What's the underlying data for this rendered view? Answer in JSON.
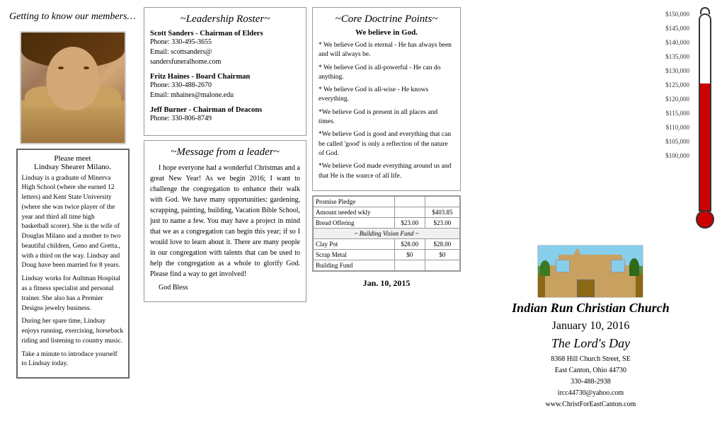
{
  "member": {
    "header": "Getting to know our members…",
    "please_meet": "Please meet",
    "name": "Lindsay Shearer Milano.",
    "bio_1": "Lindsay is a graduate of Minerva High School (where she earned 12 letters) and Kent State University (where she was twice player of the year and third all time high basketball scorer). She is the wife of Douglas Milano and a mother to two beautiful children, Geno and Gretta., with a third on the way. Lindsay and Doug have been married for 8 years.",
    "bio_2": "Lindsay works for Aultman Hospital as a fitness specialist and personal trainer. She also has a Premier Designs jewelry business.",
    "bio_3": "During her spare time, Lindsay enjoys running, exercising, horseback riding and listening to country music.",
    "bio_4": "Take a minute to introduce yourself to Lindsay today."
  },
  "leadership": {
    "title": "~Leadership Roster~",
    "leaders": [
      {
        "name": "Scott Sanders - Chairman of Elders",
        "phone": "Phone: 330-495-3655",
        "email": "Email: scottsanders@",
        "email2": "sandersfuneralhome.com"
      },
      {
        "name": "Fritz Haines - Board Chairman",
        "phone": "Phone: 330-488-2670",
        "email": "Email: mhaines@malone.edu"
      },
      {
        "name": "Jeff Burner - Chairman of Deacons",
        "phone": "Phone: 330-806-8749"
      }
    ]
  },
  "message": {
    "title": "~Message from a leader~",
    "text": "I hope everyone had a wonderful Christmas and a great New Year! As we begin 2016; I want to challenge the congregation to enhance their walk with God. We have many opportunities: gardening, scrapping, painting, building, Vacation Bible School, just to name a few. You may have a project in mind that we as a congregation can begin this year; if so I would love to learn about it. There are many people in our congregation with talents that can be used to help the congregation as a whole to glorify God. Please find a way to get involved!",
    "closing": "God Bless"
  },
  "doctrine": {
    "title": "~Core Doctrine Points~",
    "subtitle": "We believe in God.",
    "points": [
      "* We believe God is eternal - He has always been and will always be.",
      "* We believe God is all-powerful - He can do anything.",
      "* We believe God is all-wise - He knows everything.",
      "*We believe God is present in all places and times.",
      "*We believe God is good and everything that can be called 'good' is only a reflection of the nature of God.",
      "*We believe God made everything around us and that He is the source of all life."
    ]
  },
  "finance_table": {
    "rows": [
      {
        "label": "Promise Pledge",
        "col1": "",
        "col2": ""
      },
      {
        "label": "Amount needed wkly",
        "col1": "",
        "col2": "$403.85"
      },
      {
        "label": "Bread Offering",
        "col1": "$23.00",
        "col2": "$23.00"
      },
      {
        "label": "fund_header",
        "col1": "~ Building Vision Fund ~",
        "col2": ""
      },
      {
        "label": "Clay Pot",
        "col1": "$28.00",
        "col2": "$28.00"
      },
      {
        "label": "Scrap Metal",
        "col1": "$0",
        "col2": "$0"
      },
      {
        "label": "Building Fund",
        "col1": "",
        "col2": ""
      }
    ],
    "date": "Jan. 10, 2015"
  },
  "thermometer": {
    "labels": [
      "$150,000",
      "$145,000",
      "$140,000",
      "$135,000",
      "$130,000",
      "$125,000",
      "$120,000",
      "$115,000",
      "$110,000",
      "$105,000",
      "$100,000"
    ],
    "fill_percent": 65
  },
  "church": {
    "name": "Indian Run Christian Church",
    "date": "January 10, 2016",
    "lords_day": "The Lord's Day",
    "address_1": "8368 Hill Church Street, SE",
    "address_2": "East Canton, Ohio 44730",
    "phone": "330-488-2938",
    "email": "ircc44730@yahoo.com",
    "website": "www.ChristForEastCanton.com"
  }
}
